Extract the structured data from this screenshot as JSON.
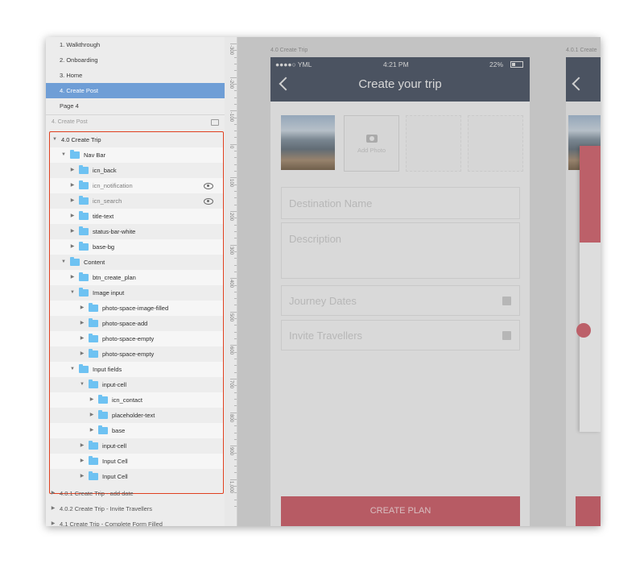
{
  "pages": [
    {
      "label": "1. Walkthrough",
      "selected": false
    },
    {
      "label": "2. Onboarding",
      "selected": false
    },
    {
      "label": "3. Home",
      "selected": false
    },
    {
      "label": "4. Create Post",
      "selected": true
    },
    {
      "label": "Page 4",
      "selected": false
    }
  ],
  "layers_header": "4. Create Post",
  "layers": [
    {
      "label": "4.0 Create Trip",
      "depth": 0,
      "expanded": true
    },
    {
      "label": "Nav Bar",
      "depth": 1,
      "expanded": true
    },
    {
      "label": "icn_back",
      "depth": 2,
      "expanded": false
    },
    {
      "label": "icn_notification",
      "depth": 2,
      "expanded": false,
      "hidden": true
    },
    {
      "label": "icn_search",
      "depth": 2,
      "expanded": false,
      "hidden": true
    },
    {
      "label": "title-text",
      "depth": 2,
      "expanded": false
    },
    {
      "label": "status-bar-white",
      "depth": 2,
      "expanded": false
    },
    {
      "label": "base-bg",
      "depth": 2,
      "expanded": false
    },
    {
      "label": "Content",
      "depth": 1,
      "expanded": true
    },
    {
      "label": "btn_create_plan",
      "depth": 2,
      "expanded": false
    },
    {
      "label": "Image input",
      "depth": 2,
      "expanded": true
    },
    {
      "label": "photo-space-image-filled",
      "depth": 3,
      "expanded": false
    },
    {
      "label": "photo-space-add",
      "depth": 3,
      "expanded": false
    },
    {
      "label": "photo-space-empty",
      "depth": 3,
      "expanded": false
    },
    {
      "label": "photo-space-empty",
      "depth": 3,
      "expanded": false
    },
    {
      "label": "Input fields",
      "depth": 2,
      "expanded": true
    },
    {
      "label": "input-cell",
      "depth": 3,
      "expanded": true
    },
    {
      "label": "icn_contact",
      "depth": 4,
      "expanded": false
    },
    {
      "label": "placeholder-text",
      "depth": 4,
      "expanded": false
    },
    {
      "label": "base",
      "depth": 4,
      "expanded": false
    },
    {
      "label": "input-cell",
      "depth": 3,
      "expanded": false
    },
    {
      "label": "Input Cell",
      "depth": 3,
      "expanded": false
    },
    {
      "label": "Input Cell",
      "depth": 3,
      "expanded": false
    }
  ],
  "footer_pages": [
    "4.0.1 Create Trip - add date",
    "4.0.2 Create Trip - Invite Travellers",
    "4.1 Create Trip - Complete Form Filled"
  ],
  "ruler_labels": [
    "-300",
    "-200",
    "-100",
    "0",
    "100",
    "200",
    "300",
    "400",
    "500",
    "600",
    "700",
    "800",
    "900",
    "1,000"
  ],
  "canvas": {
    "artboard_title": "4.0 Create Trip",
    "artboard2_title": "4.0.1 Create",
    "status_carrier": "●●●●○ YML ",
    "status_time": "4:21 PM",
    "status_battery": "22%",
    "nav_title": "Create your trip",
    "add_photo": "Add Photo",
    "destination_placeholder": "Destination Name",
    "description_placeholder": "Description",
    "dates_placeholder": "Journey Dates",
    "invite_placeholder": "Invite Travellers",
    "create_button": "CREATE PLAN"
  },
  "colors": {
    "navbar": "#3f4a5c",
    "accent": "#c9545f",
    "selection": "#6f9ed6",
    "highlight_border": "#e0401f",
    "folder": "#6ec2f2"
  }
}
